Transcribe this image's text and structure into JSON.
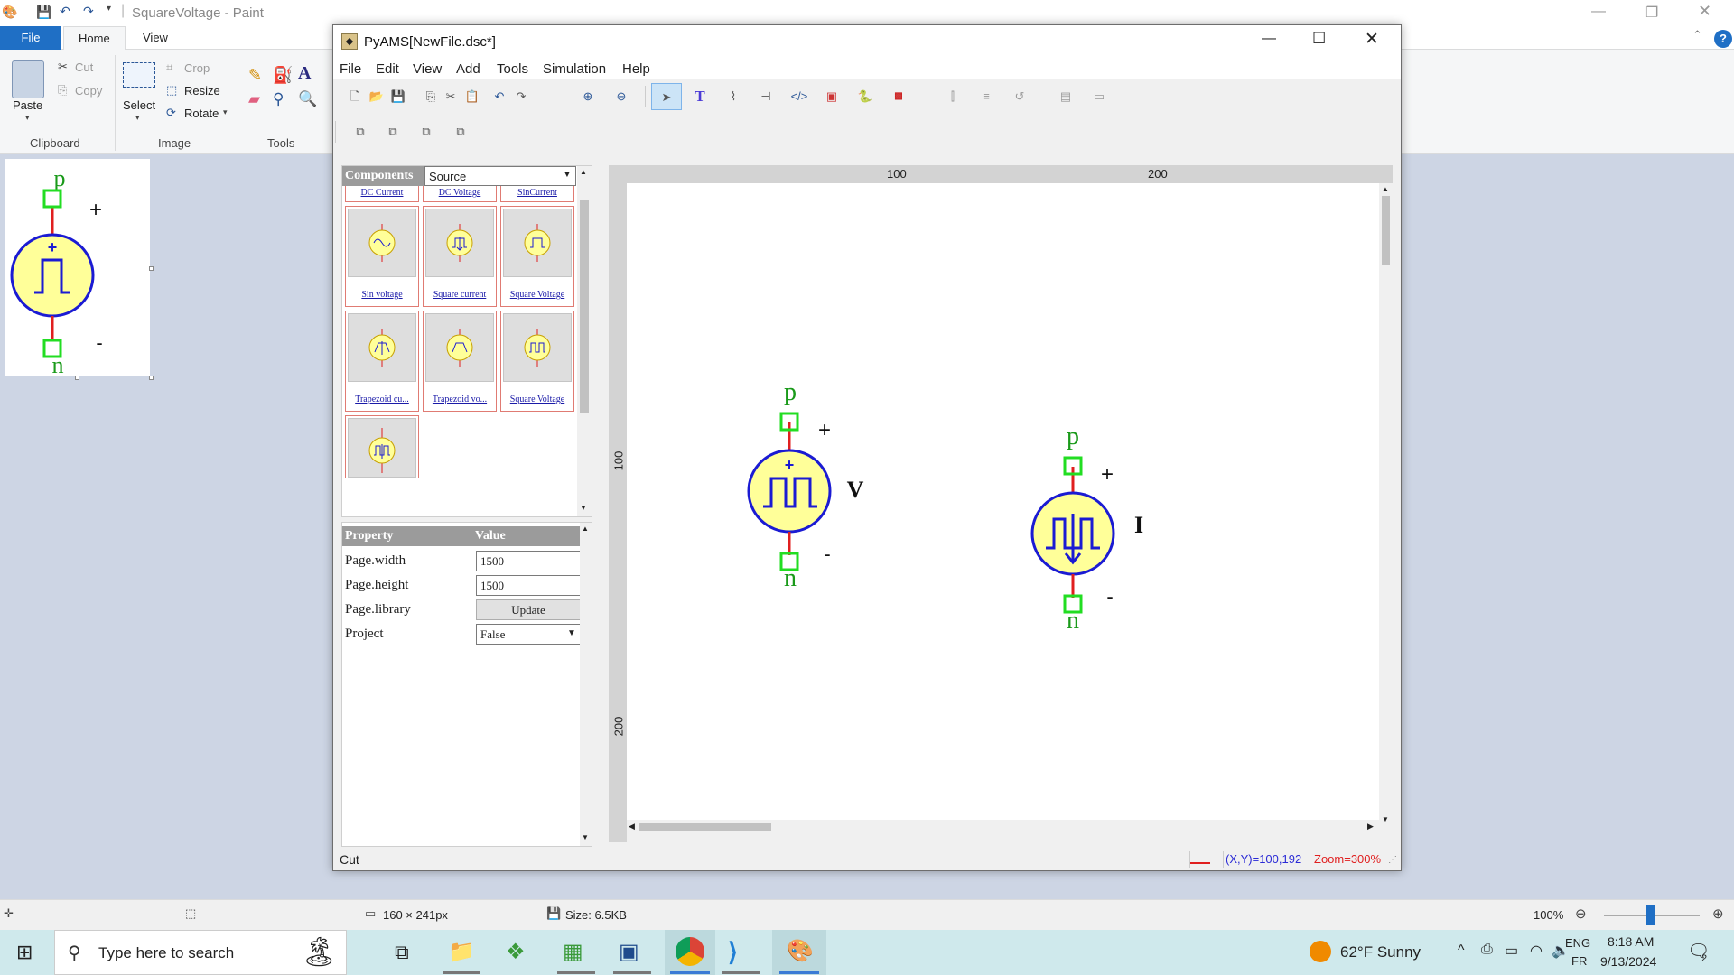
{
  "paint": {
    "title": "SquareVoltage - Paint",
    "tabs": {
      "file": "File",
      "home": "Home",
      "view": "View"
    },
    "clipboard": {
      "paste": "Paste",
      "cut": "Cut",
      "copy": "Copy",
      "label": "Clipboard"
    },
    "image": {
      "select": "Select",
      "crop": "Crop",
      "resize": "Resize",
      "rotate": "Rotate",
      "label": "Image"
    },
    "tools": {
      "label": "Tools"
    },
    "status": {
      "dimensions": "160 × 241px",
      "size": "Size: 6.5KB",
      "zoom": "100%"
    },
    "thumb": {
      "p": "p",
      "n": "n",
      "plus": "+",
      "minus": "-"
    }
  },
  "pyams": {
    "title": "PyAMS[NewFile.dsc*]",
    "menu": [
      "File",
      "Edit",
      "View",
      "Add",
      "Tools",
      "Simulation",
      "Help"
    ],
    "components": {
      "header": "Components",
      "category": "Source",
      "top_labels": [
        "DC Current",
        "DC Voltage",
        "SinCurrent"
      ],
      "cells": [
        "Sin voltage",
        "Square current",
        "Square Voltage",
        "Trapezoid cu...",
        "Trapezoid vo...",
        "Square Voltage"
      ]
    },
    "properties": {
      "header_property": "Property",
      "header_value": "Value",
      "rows": [
        {
          "name": "Page.width",
          "value": "1500"
        },
        {
          "name": "Page.height",
          "value": "1500"
        },
        {
          "name": "Page.library",
          "value": "Update"
        },
        {
          "name": "Project",
          "value": "False"
        }
      ]
    },
    "ruler": {
      "h100": "100",
      "h200": "200",
      "v100": "100",
      "v200": "200"
    },
    "schematic": {
      "voltage": {
        "p": "p",
        "n": "n",
        "plus": "+",
        "minus": "-",
        "label": "V"
      },
      "current": {
        "p": "p",
        "n": "n",
        "plus": "+",
        "minus": "-",
        "label": "I"
      }
    },
    "status": {
      "left": "Cut",
      "coords": "(X,Y)=100,192",
      "zoom": "Zoom=300%"
    }
  },
  "taskbar": {
    "search_placeholder": "Type here to search",
    "weather": "62°F  Sunny",
    "lang": "ENG",
    "lang2": "FR",
    "time": "8:18 AM",
    "date": "9/13/2024",
    "notif_count": "2"
  },
  "colors": {
    "accent": "#1f6fc5",
    "pin": "#22dd22",
    "wire": "#e01f1f",
    "source_fill": "#ffff99",
    "source_stroke": "#1b1bd3",
    "label_green": "#1a9a1a"
  }
}
